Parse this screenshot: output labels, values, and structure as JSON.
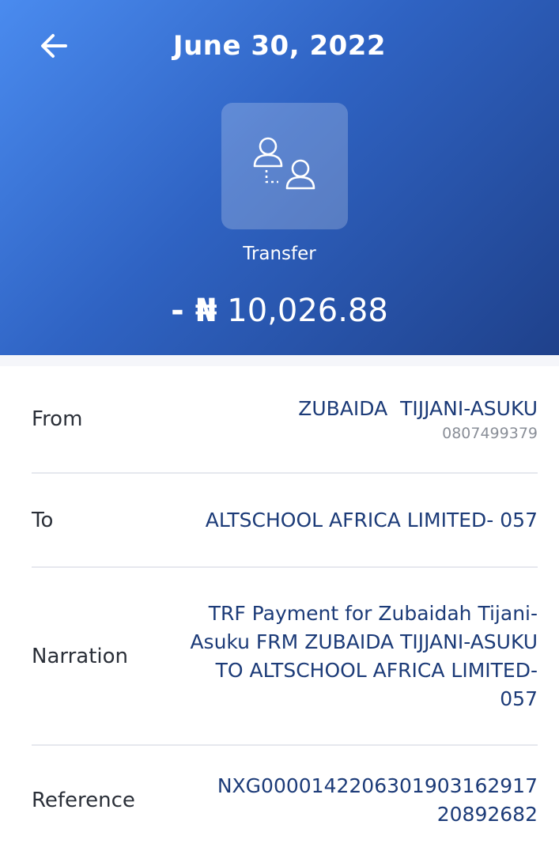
{
  "header": {
    "date": "June 30, 2022",
    "type_label": "Transfer",
    "amount_prefix": "- ₦",
    "amount_value": "10,026.88"
  },
  "details": {
    "from": {
      "label": "From",
      "name": "ZUBAIDA  TIJJANI-ASUKU",
      "account": "0807499379"
    },
    "to": {
      "label": "To",
      "value": "ALTSCHOOL AFRICA LIMITED- 057"
    },
    "narration": {
      "label": "Narration",
      "value": "TRF Payment for Zubaidah Tijani-Asuku FRM ZUBAIDA TIJJANI-ASUKU TO ALTSCHOOL AFRICA LIMITED- 057"
    },
    "reference": {
      "label": "Reference",
      "value_line1": "NXG0000142206301903162917",
      "value_line2": "20892682"
    }
  },
  "colors": {
    "header_gradient_start": "#4a8bef",
    "header_gradient_end": "#1f418b",
    "value_text": "#1c3b78",
    "label_text": "#2a2f38",
    "sub_text": "#8a8f98"
  },
  "icons": {
    "back": "arrow-left-icon",
    "transfer": "transfer-users-icon"
  }
}
